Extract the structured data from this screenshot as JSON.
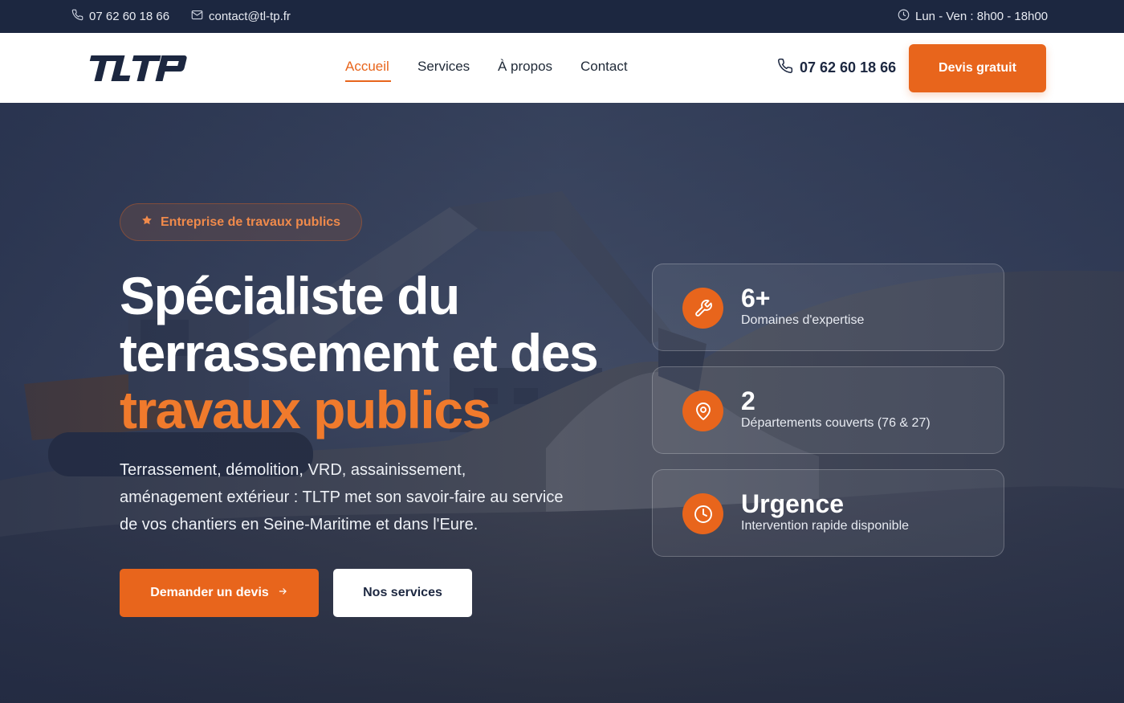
{
  "topbar": {
    "phone": "07 62 60 18 66",
    "email": "contact@tl-tp.fr",
    "hours": "Lun - Ven : 8h00 - 18h00"
  },
  "header": {
    "logo_text": "TLTP",
    "nav": [
      {
        "label": "Accueil",
        "active": true
      },
      {
        "label": "Services",
        "active": false
      },
      {
        "label": "À propos",
        "active": false
      },
      {
        "label": "Contact",
        "active": false
      }
    ],
    "phone": "07 62 60 18 66",
    "cta_label": "Devis gratuit"
  },
  "hero": {
    "badge": "Entreprise de travaux publics",
    "headline_line1": "Spécialiste du",
    "headline_line2": "terrassement et des",
    "headline_accent": "travaux publics",
    "subtext": "Terrassement, démolition, VRD, assainissement, aménagement extérieur : TLTP met son savoir-faire au service de vos chantiers en Seine-Maritime et dans l'Eure.",
    "primary_button": "Demander un devis",
    "secondary_button": "Nos services",
    "stats": [
      {
        "value": "6+",
        "label": "Domaines d'expertise",
        "icon": "wrench-icon"
      },
      {
        "value": "2",
        "label": "Départements couverts (76 & 27)",
        "icon": "map-pin-icon"
      },
      {
        "value": "Urgence",
        "label": "Intervention rapide disponible",
        "icon": "clock-icon"
      }
    ]
  },
  "colors": {
    "accent": "#e8651c",
    "navy": "#1c2740",
    "white": "#ffffff"
  }
}
